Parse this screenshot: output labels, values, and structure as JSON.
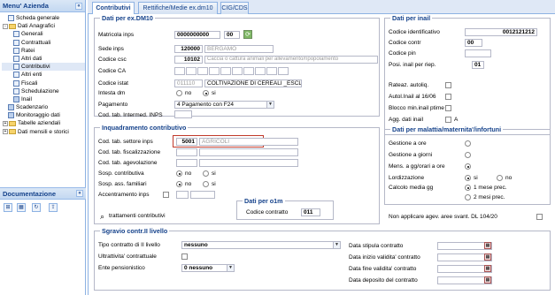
{
  "menu": {
    "title": "Menu' Azienda",
    "collapse": "«",
    "items": [
      {
        "label": "Scheda generale",
        "indent": 1,
        "icon": "page"
      },
      {
        "label": "Dati Anagrafici",
        "indent": 0,
        "icon": "folder",
        "exp": "-"
      },
      {
        "label": "Generali",
        "indent": 2,
        "icon": "page"
      },
      {
        "label": "Contrattuali",
        "indent": 2,
        "icon": "page"
      },
      {
        "label": "Ratei",
        "indent": 2,
        "icon": "page"
      },
      {
        "label": "Altri dati",
        "indent": 2,
        "icon": "page"
      },
      {
        "label": "Contributivi",
        "indent": 2,
        "icon": "page",
        "sel": true
      },
      {
        "label": "Altri enti",
        "indent": 2,
        "icon": "page"
      },
      {
        "label": "Fiscali",
        "indent": 2,
        "icon": "page"
      },
      {
        "label": "Schedulazione",
        "indent": 2,
        "icon": "page"
      },
      {
        "label": "Inail",
        "indent": 2,
        "icon": "pagei"
      },
      {
        "label": "Scadenzario",
        "indent": 1,
        "icon": "pagei"
      },
      {
        "label": "Monitoraggio dati",
        "indent": 1,
        "icon": "pagei"
      },
      {
        "label": "Tabelle aziendali",
        "indent": 0,
        "icon": "folder",
        "exp": "+"
      },
      {
        "label": "Dati mensili e storici",
        "indent": 0,
        "icon": "folder",
        "exp": "+"
      }
    ]
  },
  "doc": {
    "title": "Documentazione",
    "collapse": "«"
  },
  "tabs": [
    "Contributivi",
    "Rettifiche/Medie ex.dm10",
    "CIG/CDS"
  ],
  "dm10": {
    "legend": "Dati per ex.DM10",
    "matricola_label": "Matricola inps",
    "matricola": "0000000000",
    "matricola2": "00",
    "sede_label": "Sede inps",
    "sede_code": "120000",
    "sede_name": "BERGAMO",
    "csc_label": "Codice csc",
    "csc_code": "10102",
    "csc_desc": "Caccia o cattura animali per allevamento/ripopolamento",
    "ca_label": "Codice CA",
    "istat_label": "Codice istat",
    "istat_code": "011110",
    "istat_desc": "COLTIVAZIONE DI CEREALI _ESCLU",
    "intesta_label": "Intesta dm",
    "no": "no",
    "si": "si",
    "pag_label": "Pagamento",
    "pag_value": "4 Pagamento con F24",
    "intermed_label": "Cod. tab. Intermed. INPS"
  },
  "inq": {
    "legend": "Inquadramento contributivo",
    "settore_label": "Cod. tab. settore inps",
    "settore_code": "5001",
    "settore_desc": "AGRICOLI",
    "fisc_label": "Cod. tab. fiscalizzazione",
    "agev_label": "Cod. tab. agevolazione",
    "sosp_contr_label": "Sosp. contributiva",
    "sosp_ass_label": "Sosp. ass. familiari",
    "accent_label": "Accentramento inps",
    "no": "no",
    "si": "si",
    "tratt": "trattamenti contributivi"
  },
  "o1m": {
    "legend": "Dati per o1m",
    "cc_label": "Codice contratto",
    "cc": "011"
  },
  "inail": {
    "legend": "Dati per inail",
    "cid_label": "Codice identificativo",
    "cid": "0012121212",
    "cc_label": "Codice contr",
    "cc": "00",
    "pin_label": "Codice pin",
    "rischio_label": "Posi. inail per riep.",
    "rischio": "01",
    "rateaz": "Rateaz. autoliq.",
    "autol": "Autol.Inail al 16/06",
    "blocco": "Blocco min.inail ptime",
    "agg": "Agg. dati inail",
    "agg_a": "A"
  },
  "mal": {
    "legend": "Dati per malattia/maternita'/infortuni",
    "gestione_ore": "Gestione a ore",
    "gestione_giorni": "Gestione a giorni",
    "mens": "Mens. a gg/orari a ore",
    "lordizz": "Lordizzazione",
    "si": "si",
    "no": "no",
    "calcolo": "Calcolo media gg",
    "mesi1": "1 mese prec.",
    "mesi2": "2 mesi prec."
  },
  "nonapp": "Non applicare agev. aree svant. DL 104/20",
  "sgr": {
    "legend": "Sgravio contr.II livello",
    "tipo_label": "Tipo contratto di II livello",
    "tipo": "nessuno",
    "ultra_label": "Ultrattivita' contrattuale",
    "ente_label": "Ente pensionistico",
    "ente": "0 nessuno",
    "stip": "Data stipula contratto",
    "inizio": "Data inizio validita' contratto",
    "fine": "Data fine validita' contratto",
    "dep": "Data deposito del contratto"
  }
}
